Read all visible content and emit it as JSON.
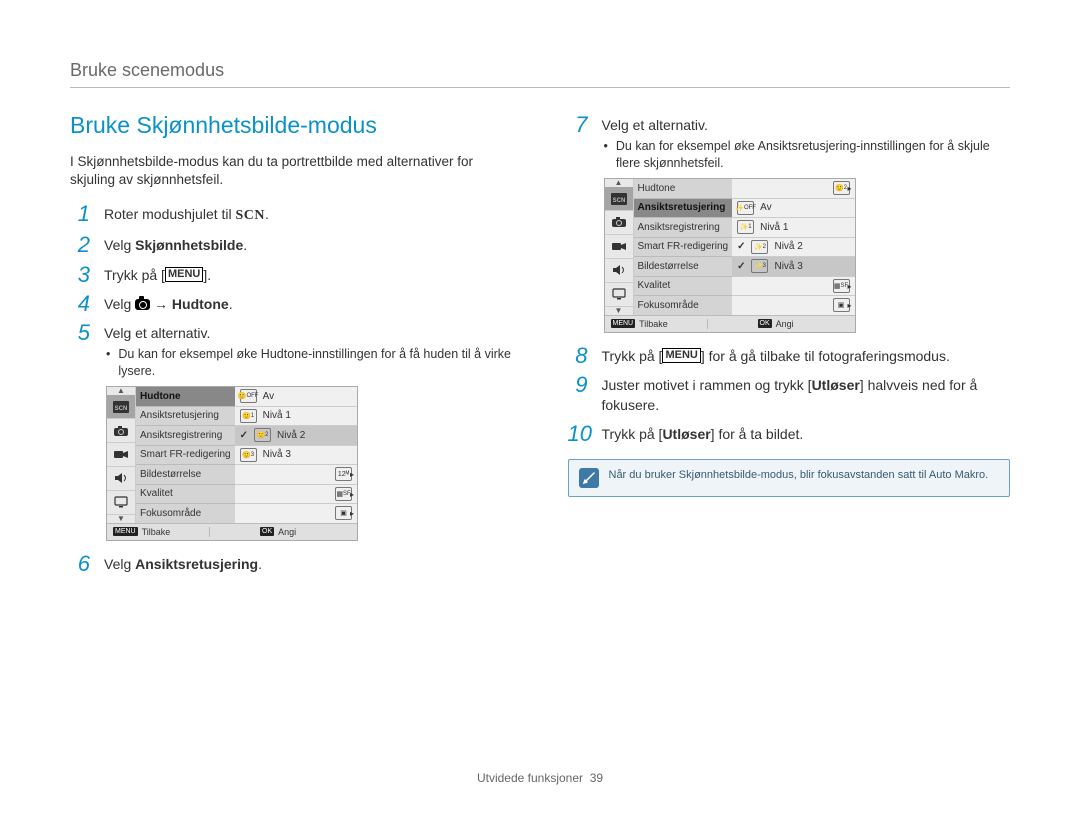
{
  "running_head": "Bruke scenemodus",
  "title": "Bruke Skjønnhetsbilde-modus",
  "intro": "I Skjønnhetsbilde-modus kan du ta portrettbilde med alternativer for skjuling av skjønnhetsfeil.",
  "steps": {
    "s1_pre": "Roter modushjulet til ",
    "s1_icon": "SCN",
    "s1_post": ".",
    "s2_pre": "Velg ",
    "s2_bold": "Skjønnhetsbilde",
    "s2_post": ".",
    "s3_pre": "Trykk på [",
    "s3_icon": "MENU",
    "s3_post": "].",
    "s4_pre": "Velg ",
    "s4_arrow": " → ",
    "s4_bold": "Hudtone",
    "s4_post": ".",
    "s5": "Velg et alternativ.",
    "s5_bullet": "Du kan for eksempel øke Hudtone-innstillingen for å få huden til å virke lysere.",
    "s6_pre": "Velg ",
    "s6_bold": "Ansiktsretusjering",
    "s6_post": ".",
    "s7": "Velg et alternativ.",
    "s7_bullet": "Du kan for eksempel øke Ansiktsretusjering-innstillingen for å skjule flere skjønnhetsfeil.",
    "s8_pre": "Trykk på [",
    "s8_icon": "MENU",
    "s8_post": "] for å gå tilbake til fotograferingsmodus.",
    "s9_pre": "Juster motivet i rammen og trykk [",
    "s9_bold": "Utløser",
    "s9_post": "] halvveis ned for å fokusere.",
    "s10_pre": "Trykk på [",
    "s10_bold": "Utløser",
    "s10_post": "] for å ta bildet."
  },
  "lcd1": {
    "menu": [
      "Hudtone",
      "Ansiktsretusjering",
      "Ansiktsregistrering",
      "Smart FR-redigering",
      "Bildestørrelse",
      "Kvalitet",
      "Fokusområde"
    ],
    "menu_sel": 0,
    "vals": [
      {
        "label": "Av",
        "icon": "off"
      },
      {
        "label": "Nivå 1",
        "icon": "1"
      },
      {
        "label": "Nivå 2",
        "icon": "2",
        "checked": true,
        "sel": true
      },
      {
        "label": "Nivå 3",
        "icon": "3"
      }
    ],
    "icons_after": [
      "12",
      "SF",
      "center"
    ],
    "foot_left_icon": "MENU",
    "foot_left": "Tilbake",
    "foot_right_icon": "OK",
    "foot_right": "Angi"
  },
  "lcd2": {
    "menu": [
      "Hudtone",
      "Ansiktsretusjering",
      "Ansiktsregistrering",
      "Smart FR-redigering",
      "Bildestørrelse",
      "Kvalitet",
      "Fokusområde"
    ],
    "menu_sel": 1,
    "vals": [
      {
        "label": "Av",
        "icon": "off"
      },
      {
        "label": "Nivå 1",
        "icon": "1"
      },
      {
        "label": "Nivå 2",
        "icon": "2",
        "checked": true
      },
      {
        "label": "Nivå 3",
        "icon": "3",
        "checked": true,
        "sel": true
      }
    ],
    "hudtone_icon": "2",
    "icons_after": [
      "SF",
      "center"
    ],
    "foot_left_icon": "MENU",
    "foot_left": "Tilbake",
    "foot_right_icon": "OK",
    "foot_right": "Angi"
  },
  "note": "Når du bruker Skjønnhetsbilde-modus, blir fokusavstanden satt til Auto Makro.",
  "footer_label": "Utvidede funksjoner",
  "footer_page": "39"
}
